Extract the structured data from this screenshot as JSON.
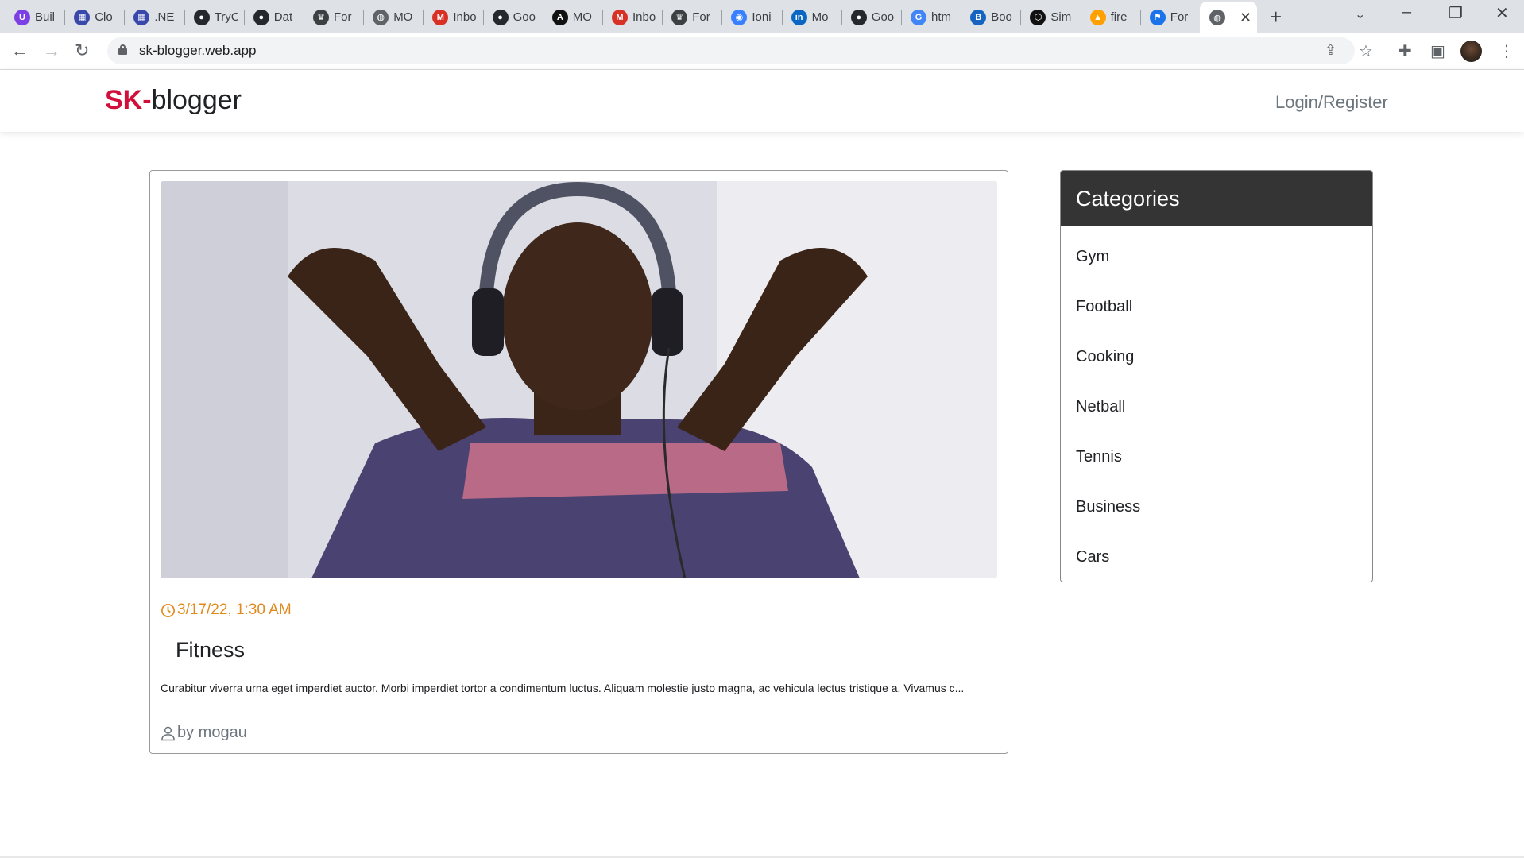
{
  "browser": {
    "tabs": [
      {
        "label": "Buil",
        "icon": "circle-u-icon",
        "color": "#7b3fe4",
        "glyph": "U"
      },
      {
        "label": "Clo",
        "icon": "cloud-bars-icon",
        "color": "#3949ab",
        "glyph": "▦"
      },
      {
        "label": ".NE",
        "icon": "cloud-bars-icon",
        "color": "#3949ab",
        "glyph": "▦"
      },
      {
        "label": "TryC",
        "icon": "github-icon",
        "color": "#24292e",
        "glyph": "●"
      },
      {
        "label": "Dat",
        "icon": "github-icon",
        "color": "#24292e",
        "glyph": "●"
      },
      {
        "label": "For",
        "icon": "trophy-icon",
        "color": "#3c4043",
        "glyph": "♛"
      },
      {
        "label": "MO",
        "icon": "globe-icon",
        "color": "#5f6368",
        "glyph": "◍"
      },
      {
        "label": "Inbo",
        "icon": "gmail-icon",
        "color": "#d93025",
        "glyph": "M"
      },
      {
        "label": "Goo",
        "icon": "github-icon",
        "color": "#24292e",
        "glyph": "●"
      },
      {
        "label": "MO",
        "icon": "angular-icon",
        "color": "#111111",
        "glyph": "A"
      },
      {
        "label": "Inbo",
        "icon": "gmail-icon",
        "color": "#d93025",
        "glyph": "M"
      },
      {
        "label": "For",
        "icon": "trophy-icon",
        "color": "#3c4043",
        "glyph": "♛"
      },
      {
        "label": "Ioni",
        "icon": "ionic-icon",
        "color": "#3880ff",
        "glyph": "◉"
      },
      {
        "label": "Mo",
        "icon": "linkedin-icon",
        "color": "#0a66c2",
        "glyph": "in"
      },
      {
        "label": "Goo",
        "icon": "github-icon",
        "color": "#24292e",
        "glyph": "●"
      },
      {
        "label": "htm",
        "icon": "google-icon",
        "color": "#4285f4",
        "glyph": "G"
      },
      {
        "label": "Boo",
        "icon": "bootstrap-icon",
        "color": "#1565c0",
        "glyph": "B"
      },
      {
        "label": "Sim",
        "icon": "hex-icon",
        "color": "#111111",
        "glyph": "⬡"
      },
      {
        "label": "fire",
        "icon": "firebase-icon",
        "color": "#ffa000",
        "glyph": "▲"
      },
      {
        "label": "For",
        "icon": "flag-icon",
        "color": "#1a73e8",
        "glyph": "⚑"
      }
    ],
    "active_tab_icon": "globe-icon",
    "url": "sk-blogger.web.app"
  },
  "site": {
    "logo_accent": "SK-",
    "logo_rest": "blogger",
    "login_label": "Login/Register"
  },
  "post": {
    "date": "3/17/22, 1:30 AM",
    "title": "Fitness",
    "excerpt": "Curabitur viverra urna eget imperdiet auctor. Morbi imperdiet tortor a condimentum luctus. Aliquam molestie justo magna, ac vehicula lectus tristique a. Vivamus c...",
    "author": "by mogau"
  },
  "categories": {
    "heading": "Categories",
    "items": [
      "Gym",
      "Football",
      "Cooking",
      "Netball",
      "Tennis",
      "Business",
      "Cars"
    ]
  },
  "colors": {
    "accent": "#d0103a",
    "date": "#e08a1e",
    "categories_header": "#343434"
  }
}
